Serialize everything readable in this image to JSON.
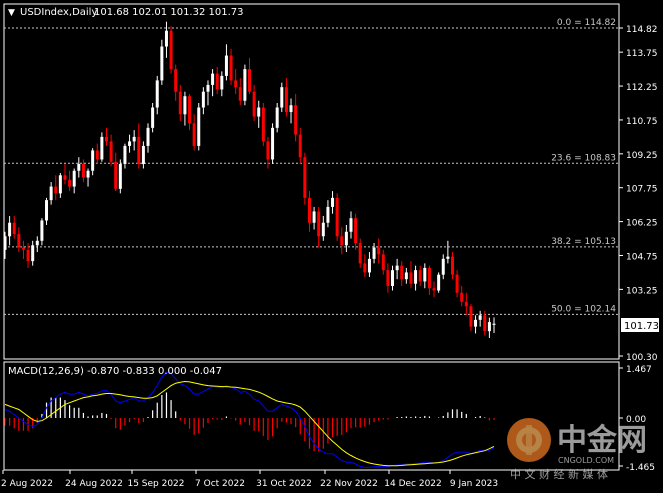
{
  "header": {
    "symbol_label": "USDIndex,Daily",
    "ohlc": "101.68 102.01 101.32 101.73"
  },
  "colors": {
    "background": "#000000",
    "frame": "#ffffff",
    "bull_candle": "#ffffff",
    "bear_candle": "#ff0000",
    "fib_line": "#c8c8c8",
    "price_tag_bg": "#ffffff",
    "macd_line": "#0000ff",
    "signal_line": "#ffff00",
    "hist_positive": "#ffffff",
    "hist_negative": "#ff0000",
    "watermark_orange": "#e87722"
  },
  "price_axis": {
    "ticks": [
      "114.82",
      "113.75",
      "112.25",
      "110.75",
      "109.25",
      "107.75",
      "106.25",
      "104.75",
      "103.25",
      "101.73",
      "100.30"
    ],
    "current_price": "101.73"
  },
  "fib_levels": [
    {
      "label": "0.0 = 114.82",
      "price": 114.82
    },
    {
      "label": "23.6 = 108.83",
      "price": 108.83
    },
    {
      "label": "38.2 = 105.13",
      "price": 105.13
    },
    {
      "label": "50.0 = 102.14",
      "price": 102.14
    }
  ],
  "macd": {
    "label": "MACD(12,26,9) -0.870 -0.833 0.000 -0.047",
    "axis_ticks": [
      "1.467",
      "0.00",
      "-1.465"
    ]
  },
  "time_axis": [
    "2 Aug 2022",
    "24 Aug 2022",
    "15 Sep 2022",
    "7 Oct 2022",
    "31 Oct 2022",
    "22 Nov 2022",
    "14 Dec 2022",
    "9 Jan 2023"
  ],
  "watermark": {
    "logo_text": "中金网",
    "url": "CNGOLD.COM",
    "tagline": "中 文 财 经 新 媒 体"
  },
  "chart_data": {
    "type": "candlestick",
    "title": "USDIndex,Daily",
    "ylim": [
      100.3,
      115.5
    ],
    "candles": [
      [
        105.0,
        105.8,
        104.6,
        105.6
      ],
      [
        105.6,
        106.5,
        105.2,
        106.2
      ],
      [
        106.2,
        106.5,
        105.5,
        105.7
      ],
      [
        105.7,
        106.0,
        104.9,
        105.1
      ],
      [
        105.1,
        105.4,
        104.6,
        105.0
      ],
      [
        105.0,
        105.3,
        104.2,
        104.5
      ],
      [
        104.5,
        105.4,
        104.3,
        105.2
      ],
      [
        105.2,
        105.6,
        104.9,
        105.4
      ],
      [
        105.4,
        106.4,
        105.2,
        106.3
      ],
      [
        106.3,
        107.3,
        106.1,
        107.2
      ],
      [
        107.2,
        108.0,
        107.0,
        107.8
      ],
      [
        107.8,
        108.3,
        107.2,
        107.5
      ],
      [
        107.5,
        108.4,
        107.3,
        108.3
      ],
      [
        108.3,
        108.8,
        107.9,
        108.1
      ],
      [
        108.1,
        108.5,
        107.6,
        107.8
      ],
      [
        107.8,
        108.6,
        107.5,
        108.5
      ],
      [
        108.5,
        109.1,
        108.2,
        108.8
      ],
      [
        108.8,
        109.0,
        108.0,
        108.2
      ],
      [
        108.2,
        108.6,
        107.8,
        108.5
      ],
      [
        108.5,
        109.5,
        108.3,
        109.4
      ],
      [
        109.4,
        109.7,
        108.8,
        109.0
      ],
      [
        109.0,
        110.2,
        108.9,
        110.0
      ],
      [
        110.0,
        110.4,
        109.6,
        109.8
      ],
      [
        109.8,
        110.1,
        108.7,
        108.9
      ],
      [
        108.9,
        109.3,
        107.6,
        107.7
      ],
      [
        107.7,
        109.0,
        107.5,
        108.8
      ],
      [
        108.8,
        109.7,
        108.6,
        109.6
      ],
      [
        109.6,
        110.1,
        109.3,
        109.8
      ],
      [
        109.8,
        110.3,
        109.4,
        110.0
      ],
      [
        110.0,
        110.6,
        108.6,
        108.8
      ],
      [
        108.8,
        109.8,
        108.6,
        109.6
      ],
      [
        109.6,
        110.6,
        109.3,
        110.4
      ],
      [
        110.4,
        111.5,
        110.2,
        111.3
      ],
      [
        111.3,
        112.7,
        111.0,
        112.5
      ],
      [
        112.5,
        114.3,
        112.3,
        114.0
      ],
      [
        114.0,
        115.1,
        113.5,
        114.7
      ],
      [
        114.7,
        114.9,
        112.8,
        113.0
      ],
      [
        113.0,
        113.2,
        111.6,
        112.0
      ],
      [
        112.0,
        112.3,
        110.7,
        111.0
      ],
      [
        111.0,
        112.0,
        110.5,
        111.8
      ],
      [
        111.8,
        111.9,
        110.3,
        110.6
      ],
      [
        110.6,
        111.0,
        109.4,
        109.6
      ],
      [
        109.6,
        111.5,
        109.4,
        111.3
      ],
      [
        111.3,
        112.2,
        111.0,
        112.0
      ],
      [
        112.0,
        112.5,
        111.4,
        112.3
      ],
      [
        112.3,
        113.0,
        111.8,
        112.8
      ],
      [
        112.8,
        113.1,
        111.9,
        112.1
      ],
      [
        112.1,
        112.9,
        111.8,
        112.7
      ],
      [
        112.7,
        114.1,
        112.5,
        113.6
      ],
      [
        113.6,
        113.9,
        112.3,
        112.5
      ],
      [
        112.5,
        113.0,
        111.9,
        112.2
      ],
      [
        112.2,
        112.6,
        111.4,
        111.6
      ],
      [
        111.6,
        113.2,
        111.4,
        113.0
      ],
      [
        113.0,
        113.5,
        111.9,
        112.0
      ],
      [
        112.0,
        112.3,
        110.7,
        110.9
      ],
      [
        110.9,
        111.6,
        110.4,
        111.3
      ],
      [
        111.3,
        111.5,
        109.6,
        109.8
      ],
      [
        109.8,
        110.0,
        108.6,
        109.0
      ],
      [
        109.0,
        110.6,
        108.8,
        110.4
      ],
      [
        110.4,
        111.5,
        110.2,
        111.3
      ],
      [
        111.3,
        112.4,
        111.1,
        112.2
      ],
      [
        112.2,
        112.6,
        110.9,
        111.1
      ],
      [
        111.1,
        111.7,
        110.6,
        111.4
      ],
      [
        111.4,
        111.9,
        109.8,
        110.1
      ],
      [
        110.1,
        110.4,
        108.8,
        109.1
      ],
      [
        109.1,
        109.3,
        107.0,
        107.3
      ],
      [
        107.3,
        107.6,
        105.8,
        106.2
      ],
      [
        106.2,
        106.9,
        105.9,
        106.7
      ],
      [
        106.7,
        106.9,
        105.1,
        105.6
      ],
      [
        105.6,
        106.5,
        105.4,
        106.2
      ],
      [
        106.2,
        107.2,
        106.0,
        106.9
      ],
      [
        106.9,
        107.6,
        106.6,
        107.3
      ],
      [
        107.3,
        107.5,
        105.4,
        105.6
      ],
      [
        105.6,
        106.0,
        104.8,
        105.2
      ],
      [
        105.2,
        106.1,
        104.9,
        105.8
      ],
      [
        105.8,
        106.7,
        105.5,
        106.4
      ],
      [
        106.4,
        106.6,
        105.0,
        105.3
      ],
      [
        105.3,
        105.5,
        104.2,
        104.4
      ],
      [
        104.4,
        104.8,
        103.8,
        104.0
      ],
      [
        104.0,
        104.9,
        103.8,
        104.6
      ],
      [
        104.6,
        105.3,
        104.4,
        105.1
      ],
      [
        105.1,
        105.5,
        104.4,
        104.8
      ],
      [
        104.8,
        105.0,
        103.9,
        104.1
      ],
      [
        104.1,
        104.4,
        103.1,
        103.4
      ],
      [
        103.4,
        104.3,
        103.2,
        104.1
      ],
      [
        104.1,
        104.6,
        103.7,
        104.3
      ],
      [
        104.3,
        104.5,
        103.4,
        103.7
      ],
      [
        103.7,
        104.2,
        103.5,
        104.0
      ],
      [
        104.0,
        104.5,
        103.3,
        103.5
      ],
      [
        103.5,
        104.3,
        103.2,
        104.1
      ],
      [
        104.1,
        104.3,
        103.4,
        103.6
      ],
      [
        103.6,
        104.4,
        103.3,
        104.2
      ],
      [
        104.2,
        104.3,
        103.0,
        103.3
      ],
      [
        103.3,
        103.6,
        102.9,
        103.2
      ],
      [
        103.2,
        104.0,
        103.1,
        103.9
      ],
      [
        103.9,
        104.8,
        103.7,
        104.6
      ],
      [
        104.6,
        105.4,
        104.4,
        104.7
      ],
      [
        104.7,
        104.9,
        103.7,
        103.9
      ],
      [
        103.9,
        104.1,
        102.9,
        103.1
      ],
      [
        103.1,
        103.4,
        102.5,
        102.7
      ],
      [
        102.7,
        103.1,
        102.1,
        102.5
      ],
      [
        102.5,
        102.6,
        101.4,
        101.6
      ],
      [
        101.6,
        102.1,
        101.3,
        101.9
      ],
      [
        101.9,
        102.3,
        101.6,
        102.1
      ],
      [
        102.1,
        102.3,
        101.2,
        101.4
      ],
      [
        101.4,
        102.0,
        101.1,
        101.8
      ],
      [
        101.68,
        102.01,
        101.32,
        101.73
      ]
    ],
    "macd_main": [
      0.25,
      0.2,
      0.1,
      0.0,
      -0.1,
      -0.2,
      -0.25,
      -0.2,
      0.0,
      0.3,
      0.5,
      0.6,
      0.7,
      0.75,
      0.7,
      0.7,
      0.75,
      0.7,
      0.65,
      0.7,
      0.72,
      0.8,
      0.8,
      0.7,
      0.5,
      0.45,
      0.5,
      0.55,
      0.6,
      0.5,
      0.5,
      0.6,
      0.75,
      0.95,
      1.2,
      1.35,
      1.3,
      1.15,
      1.0,
      0.95,
      0.85,
      0.7,
      0.7,
      0.78,
      0.85,
      0.92,
      0.9,
      0.88,
      0.95,
      0.9,
      0.85,
      0.75,
      0.78,
      0.7,
      0.55,
      0.5,
      0.35,
      0.2,
      0.2,
      0.3,
      0.4,
      0.35,
      0.3,
      0.2,
      0.0,
      -0.25,
      -0.55,
      -0.75,
      -0.9,
      -1.0,
      -1.05,
      -1.05,
      -1.15,
      -1.25,
      -1.3,
      -1.3,
      -1.35,
      -1.42,
      -1.45,
      -1.45,
      -1.43,
      -1.42,
      -1.42,
      -1.43,
      -1.4,
      -1.38,
      -1.37,
      -1.35,
      -1.35,
      -1.33,
      -1.33,
      -1.3,
      -1.3,
      -1.32,
      -1.3,
      -1.25,
      -1.15,
      -1.05,
      -1.0,
      -1.0,
      -1.0,
      -1.05,
      -1.0,
      -0.95,
      -0.95,
      -0.95,
      -0.87
    ],
    "macd_signal": [
      0.4,
      0.35,
      0.3,
      0.25,
      0.15,
      0.05,
      -0.05,
      -0.1,
      -0.08,
      0.0,
      0.1,
      0.2,
      0.3,
      0.4,
      0.45,
      0.5,
      0.55,
      0.6,
      0.62,
      0.65,
      0.67,
      0.7,
      0.72,
      0.72,
      0.7,
      0.68,
      0.65,
      0.63,
      0.62,
      0.6,
      0.58,
      0.58,
      0.6,
      0.65,
      0.75,
      0.85,
      0.95,
      1.02,
      1.05,
      1.07,
      1.06,
      1.03,
      1.0,
      0.97,
      0.95,
      0.94,
      0.93,
      0.92,
      0.92,
      0.91,
      0.9,
      0.88,
      0.86,
      0.84,
      0.8,
      0.76,
      0.7,
      0.63,
      0.56,
      0.5,
      0.47,
      0.44,
      0.42,
      0.38,
      0.32,
      0.2,
      0.05,
      -0.1,
      -0.25,
      -0.4,
      -0.55,
      -0.68,
      -0.8,
      -0.92,
      -1.02,
      -1.1,
      -1.17,
      -1.23,
      -1.28,
      -1.32,
      -1.35,
      -1.37,
      -1.39,
      -1.4,
      -1.4,
      -1.4,
      -1.39,
      -1.38,
      -1.37,
      -1.36,
      -1.35,
      -1.34,
      -1.33,
      -1.32,
      -1.31,
      -1.29,
      -1.26,
      -1.22,
      -1.17,
      -1.12,
      -1.08,
      -1.05,
      -1.02,
      -0.99,
      -0.96,
      -0.9,
      -0.833
    ]
  }
}
